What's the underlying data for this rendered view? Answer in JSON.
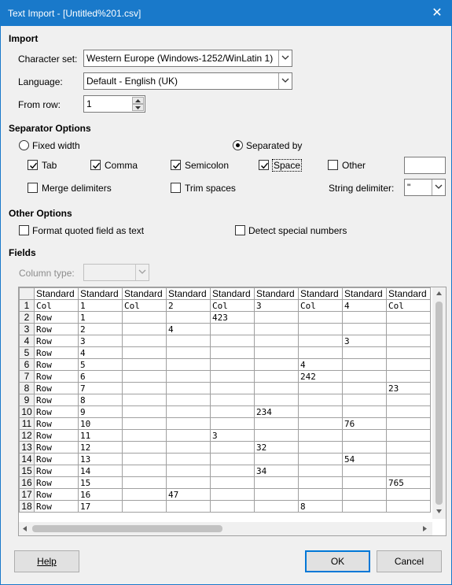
{
  "window": {
    "title": "Text Import - [Untitled%201.csv]"
  },
  "import": {
    "heading": "Import",
    "charset_label": "Character set:",
    "charset_value": "Western Europe (Windows-1252/WinLatin 1)",
    "language_label": "Language:",
    "language_value": "Default - English (UK)",
    "fromrow_label": "From row:",
    "fromrow_value": "1"
  },
  "separator": {
    "heading": "Separator Options",
    "fixed_width": "Fixed width",
    "separated_by": "Separated by",
    "selected_mode": "separated_by",
    "tab": "Tab",
    "tab_checked": true,
    "comma": "Comma",
    "comma_checked": true,
    "semicolon": "Semicolon",
    "semicolon_checked": true,
    "space": "Space",
    "space_checked": true,
    "other": "Other",
    "other_checked": false,
    "other_value": "",
    "merge": "Merge delimiters",
    "merge_checked": false,
    "trim": "Trim spaces",
    "trim_checked": false,
    "string_delim_label": "String delimiter:",
    "string_delim_value": "\""
  },
  "other_options": {
    "heading": "Other Options",
    "format_quoted": "Format quoted field as text",
    "format_quoted_checked": false,
    "detect_special": "Detect special numbers",
    "detect_special_checked": false
  },
  "fields": {
    "heading": "Fields",
    "column_type_label": "Column type:",
    "column_type_value": "",
    "headers": [
      "Standard",
      "Standard",
      "Standard",
      "Standard",
      "Standard",
      "Standard",
      "Standard",
      "Standard",
      "Standard"
    ],
    "rows": [
      [
        "1",
        [
          "Col",
          "1",
          "Col",
          "2",
          "Col",
          "3",
          "Col",
          "4",
          "Col"
        ]
      ],
      [
        "2",
        [
          "Row",
          "1",
          "",
          "",
          "423",
          "",
          "",
          "",
          ""
        ]
      ],
      [
        "3",
        [
          "Row",
          "2",
          "",
          "4",
          "",
          "",
          "",
          "",
          ""
        ]
      ],
      [
        "4",
        [
          "Row",
          "3",
          "",
          "",
          "",
          "",
          "",
          "3",
          ""
        ]
      ],
      [
        "5",
        [
          "Row",
          "4",
          "",
          "",
          "",
          "",
          "",
          "",
          ""
        ]
      ],
      [
        "6",
        [
          "Row",
          "5",
          "",
          "",
          "",
          "",
          "4",
          "",
          ""
        ]
      ],
      [
        "7",
        [
          "Row",
          "6",
          "",
          "",
          "",
          "",
          "242",
          "",
          ""
        ]
      ],
      [
        "8",
        [
          "Row",
          "7",
          "",
          "",
          "",
          "",
          "",
          "",
          "23"
        ]
      ],
      [
        "9",
        [
          "Row",
          "8",
          "",
          "",
          "",
          "",
          "",
          "",
          ""
        ]
      ],
      [
        "10",
        [
          "Row",
          "9",
          "",
          "",
          "",
          "234",
          "",
          "",
          ""
        ]
      ],
      [
        "11",
        [
          "Row",
          "10",
          "",
          "",
          "",
          "",
          "",
          "76",
          ""
        ]
      ],
      [
        "12",
        [
          "Row",
          "11",
          "",
          "",
          "3",
          "",
          "",
          "",
          ""
        ]
      ],
      [
        "13",
        [
          "Row",
          "12",
          "",
          "",
          "",
          "32",
          "",
          "",
          ""
        ]
      ],
      [
        "14",
        [
          "Row",
          "13",
          "",
          "",
          "",
          "",
          "",
          "54",
          ""
        ]
      ],
      [
        "15",
        [
          "Row",
          "14",
          "",
          "",
          "",
          "34",
          "",
          "",
          ""
        ]
      ],
      [
        "16",
        [
          "Row",
          "15",
          "",
          "",
          "",
          "",
          "",
          "",
          "765"
        ]
      ],
      [
        "17",
        [
          "Row",
          "16",
          "",
          "47",
          "",
          "",
          "",
          "",
          ""
        ]
      ],
      [
        "18",
        [
          "Row",
          "17",
          "",
          "",
          "",
          "",
          "8",
          "",
          ""
        ]
      ]
    ]
  },
  "buttons": {
    "help": "Help",
    "ok": "OK",
    "cancel": "Cancel"
  },
  "colors": {
    "titlebar": "#1979ca",
    "default_button_border": "#0078d7"
  }
}
